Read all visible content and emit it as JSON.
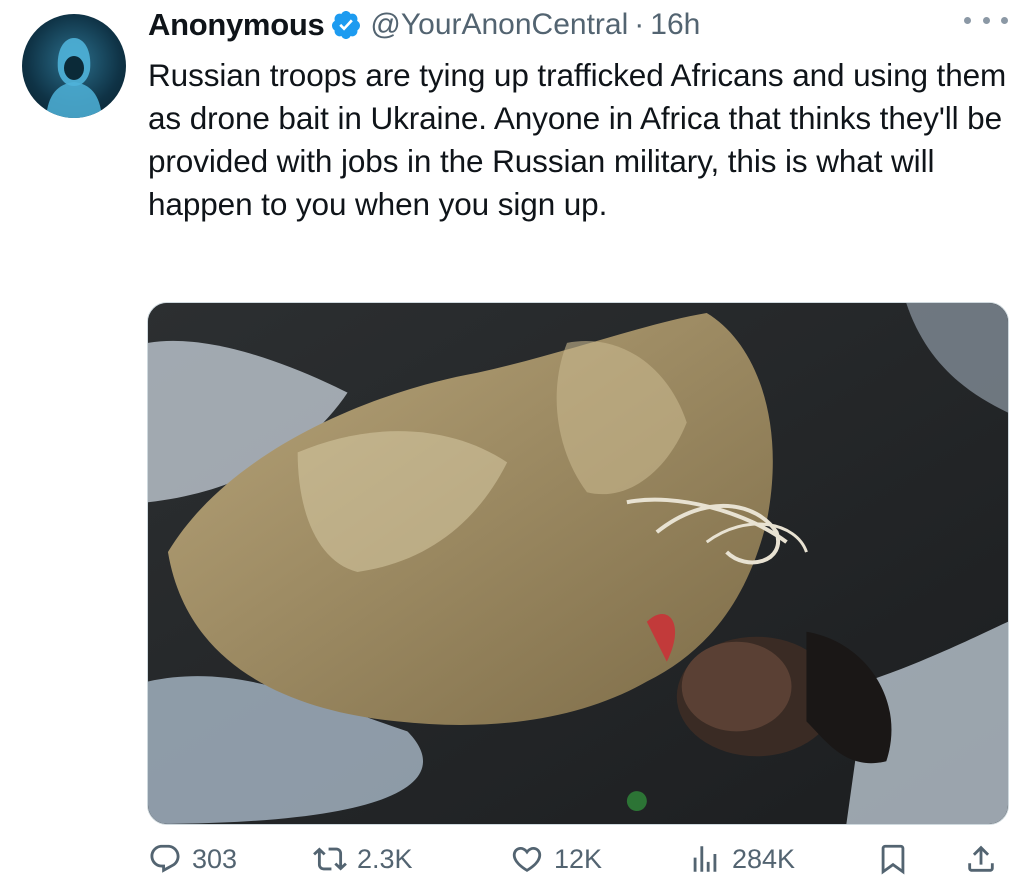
{
  "author": {
    "display_name": "Anonymous",
    "handle": "@YourAnonCentral",
    "separator": "·",
    "time": "16h",
    "verified": true
  },
  "tweet": {
    "text": "Russian troops are tying up trafficked Africans and using them as drone bait in Ukraine. Anyone in Africa that thinks they'll be provided with jobs in the Russian military, this is what will happen to you when you sign up."
  },
  "actions": {
    "replies": "303",
    "retweets": "2.3K",
    "likes": "12K",
    "views": "284K"
  },
  "icons": {
    "more": "more-icon",
    "reply": "reply-icon",
    "retweet": "retweet-icon",
    "like": "heart-icon",
    "views": "views-icon",
    "bookmark": "bookmark-icon",
    "share": "share-icon"
  },
  "colors": {
    "verified": "#1d9bf0",
    "text": "#0f1419",
    "secondary": "#536471"
  }
}
